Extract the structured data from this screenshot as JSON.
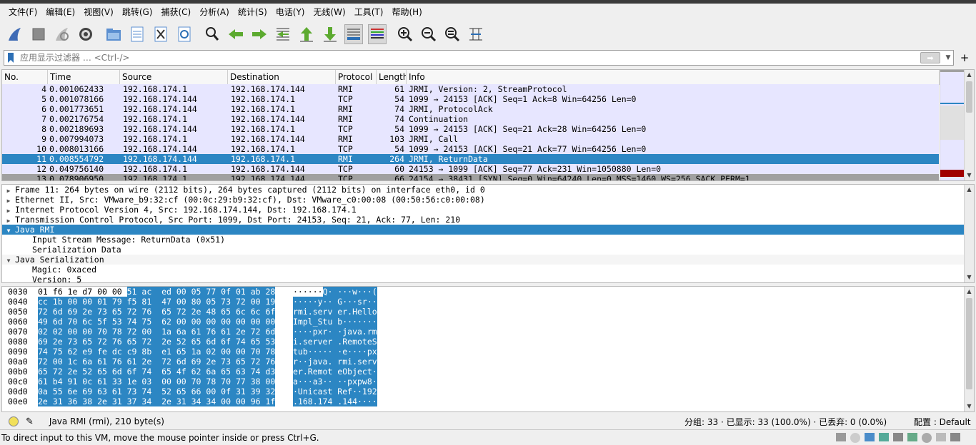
{
  "menu": [
    "文件(F)",
    "编辑(E)",
    "视图(V)",
    "跳转(G)",
    "捕获(C)",
    "分析(A)",
    "统计(S)",
    "电话(Y)",
    "无线(W)",
    "工具(T)",
    "帮助(H)"
  ],
  "toolbar": {
    "icons": [
      "shark-fin-icon",
      "stop-icon",
      "restart-icon",
      "gear-icon",
      "open-folder-icon",
      "save-file-icon",
      "close-file-icon",
      "reload-icon",
      "search-icon",
      "back-arrow-icon",
      "forward-arrow-icon",
      "goto-packet-icon",
      "first-packet-icon",
      "last-packet-icon",
      "autoscroll-icon",
      "colorize-icon",
      "zoom-in-icon",
      "zoom-out-icon",
      "zoom-reset-icon",
      "resize-columns-icon"
    ]
  },
  "filter": {
    "placeholder": "应用显示过滤器 … <Ctrl-/>",
    "apply_label": "➡",
    "add_label": "+"
  },
  "columns": [
    "No.",
    "Time",
    "Source",
    "Destination",
    "Protocol",
    "Length",
    "Info"
  ],
  "packets": [
    {
      "no": "4",
      "time": "0.001062433",
      "src": "192.168.174.1",
      "dst": "192.168.174.144",
      "proto": "RMI",
      "len": "61",
      "info": "JRMI, Version: 2, StreamProtocol",
      "kind": "rmi"
    },
    {
      "no": "5",
      "time": "0.001078166",
      "src": "192.168.174.144",
      "dst": "192.168.174.1",
      "proto": "TCP",
      "len": "54",
      "info": "1099 → 24153 [ACK] Seq=1 Ack=8 Win=64256 Len=0",
      "kind": "tcp"
    },
    {
      "no": "6",
      "time": "0.001773651",
      "src": "192.168.174.144",
      "dst": "192.168.174.1",
      "proto": "RMI",
      "len": "74",
      "info": "JRMI, ProtocolAck",
      "kind": "rmi"
    },
    {
      "no": "7",
      "time": "0.002176754",
      "src": "192.168.174.1",
      "dst": "192.168.174.144",
      "proto": "RMI",
      "len": "74",
      "info": "Continuation",
      "kind": "rmi"
    },
    {
      "no": "8",
      "time": "0.002189693",
      "src": "192.168.174.144",
      "dst": "192.168.174.1",
      "proto": "TCP",
      "len": "54",
      "info": "1099 → 24153 [ACK] Seq=21 Ack=28 Win=64256 Len=0",
      "kind": "tcp"
    },
    {
      "no": "9",
      "time": "0.007994073",
      "src": "192.168.174.1",
      "dst": "192.168.174.144",
      "proto": "RMI",
      "len": "103",
      "info": "JRMI, Call",
      "kind": "rmi"
    },
    {
      "no": "10",
      "time": "0.008013166",
      "src": "192.168.174.144",
      "dst": "192.168.174.1",
      "proto": "TCP",
      "len": "54",
      "info": "1099 → 24153 [ACK] Seq=21 Ack=77 Win=64256 Len=0",
      "kind": "tcp"
    },
    {
      "no": "11",
      "time": "0.008554792",
      "src": "192.168.174.144",
      "dst": "192.168.174.1",
      "proto": "RMI",
      "len": "264",
      "info": "JRMI, ReturnData",
      "kind": "sel"
    },
    {
      "no": "12",
      "time": "0.049756140",
      "src": "192.168.174.1",
      "dst": "192.168.174.144",
      "proto": "TCP",
      "len": "60",
      "info": "24153 → 1099 [ACK] Seq=77 Ack=231 Win=1050880 Len=0",
      "kind": "tcp"
    },
    {
      "no": "13",
      "time": "0.078906950",
      "src": "192.168.174.1",
      "dst": "192.168.174.144",
      "proto": "TCP",
      "len": "66",
      "info": "24154 → 38431 [SYN] Seq=0 Win=64240 Len=0 MSS=1460 WS=256 SACK_PERM=1",
      "kind": "syn"
    }
  ],
  "details": [
    {
      "text": "Frame 11: 264 bytes on wire (2112 bits), 264 bytes captured (2112 bits) on interface eth0, id 0",
      "tri": "▶",
      "state": "normal"
    },
    {
      "text": "Ethernet II, Src: VMware_b9:32:cf (00:0c:29:b9:32:cf), Dst: VMware_c0:00:08 (00:50:56:c0:00:08)",
      "tri": "▶",
      "state": "normal"
    },
    {
      "text": "Internet Protocol Version 4, Src: 192.168.174.144, Dst: 192.168.174.1",
      "tri": "▶",
      "state": "normal"
    },
    {
      "text": "Transmission Control Protocol, Src Port: 1099, Dst Port: 24153, Seq: 21, Ack: 77, Len: 210",
      "tri": "▶",
      "state": "normal"
    },
    {
      "text": "Java RMI",
      "tri": "▼",
      "state": "selected"
    },
    {
      "text": "Input Stream Message: ReturnData (0x51)",
      "tri": "",
      "state": "child"
    },
    {
      "text": "Serialization Data",
      "tri": "",
      "state": "child"
    },
    {
      "text": "Java Serialization",
      "tri": "▼",
      "state": "alt"
    },
    {
      "text": "Magic: 0xaced",
      "tri": "",
      "state": "child"
    },
    {
      "text": "Version: 5",
      "tri": "",
      "state": "child"
    }
  ],
  "bytes": [
    {
      "off": "0030",
      "hex_a": "01 f6 1e d7 00 00 ",
      "hex_b": "51 ac  ed 00 05 77 0f 01 ab 28",
      "asc_a": "······",
      "asc_b": "Q· ···w···("
    },
    {
      "off": "0040",
      "hex_a": "",
      "hex_b": "cc 1b 00 00 01 79 f5 81  47 00 80 05 73 72 00 19",
      "asc_a": "",
      "asc_b": "·····y·· G···sr··"
    },
    {
      "off": "0050",
      "hex_a": "",
      "hex_b": "72 6d 69 2e 73 65 72 76  65 72 2e 48 65 6c 6c 6f",
      "asc_a": "",
      "asc_b": "rmi.serv er.Hello"
    },
    {
      "off": "0060",
      "hex_a": "",
      "hex_b": "49 6d 70 6c 5f 53 74 75  62 00 00 00 00 00 00 00",
      "asc_a": "",
      "asc_b": "Impl_Stu b·······"
    },
    {
      "off": "0070",
      "hex_a": "",
      "hex_b": "02 02 00 00 70 78 72 00  1a 6a 61 76 61 2e 72 6d",
      "asc_a": "",
      "asc_b": "····pxr· ·java.rm"
    },
    {
      "off": "0080",
      "hex_a": "",
      "hex_b": "69 2e 73 65 72 76 65 72  2e 52 65 6d 6f 74 65 53",
      "asc_a": "",
      "asc_b": "i.server .RemoteS"
    },
    {
      "off": "0090",
      "hex_a": "",
      "hex_b": "74 75 62 e9 fe dc c9 8b  e1 65 1a 02 00 00 70 78",
      "asc_a": "",
      "asc_b": "tub····· ·e····px"
    },
    {
      "off": "00a0",
      "hex_a": "",
      "hex_b": "72 00 1c 6a 61 76 61 2e  72 6d 69 2e 73 65 72 76",
      "asc_a": "",
      "asc_b": "r··java. rmi.serv"
    },
    {
      "off": "00b0",
      "hex_a": "",
      "hex_b": "65 72 2e 52 65 6d 6f 74  65 4f 62 6a 65 63 74 d3",
      "asc_a": "",
      "asc_b": "er.Remot eObject·"
    },
    {
      "off": "00c0",
      "hex_a": "",
      "hex_b": "61 b4 91 0c 61 33 1e 03  00 00 70 78 70 77 38 00",
      "asc_a": "",
      "asc_b": "a···a3·· ··pxpw8·"
    },
    {
      "off": "00d0",
      "hex_a": "",
      "hex_b": "0a 55 6e 69 63 61 73 74  52 65 66 00 0f 31 39 32",
      "asc_a": "",
      "asc_b": "·Unicast Ref··192"
    },
    {
      "off": "00e0",
      "hex_a": "",
      "hex_b": "2e 31 36 38 2e 31 37 34  2e 31 34 34 00 00 96 1f",
      "asc_a": "",
      "asc_b": ".168.174 .144····"
    }
  ],
  "status": {
    "protocol_info": "Java RMI (rmi), 210 byte(s)",
    "packets_info": "分组: 33 · 已显示: 33 (100.0%) · 已丢弃: 0 (0.0%)",
    "profile": "配置 : Default"
  },
  "vm_hint": "To direct input to this VM, move the mouse pointer inside or press Ctrl+G.",
  "colors": {
    "selection": "#2c86c3",
    "rmi_row": "#e7e6ff",
    "tcp_row": "#e7e6ff",
    "syn_row": "#a0a0a0"
  }
}
